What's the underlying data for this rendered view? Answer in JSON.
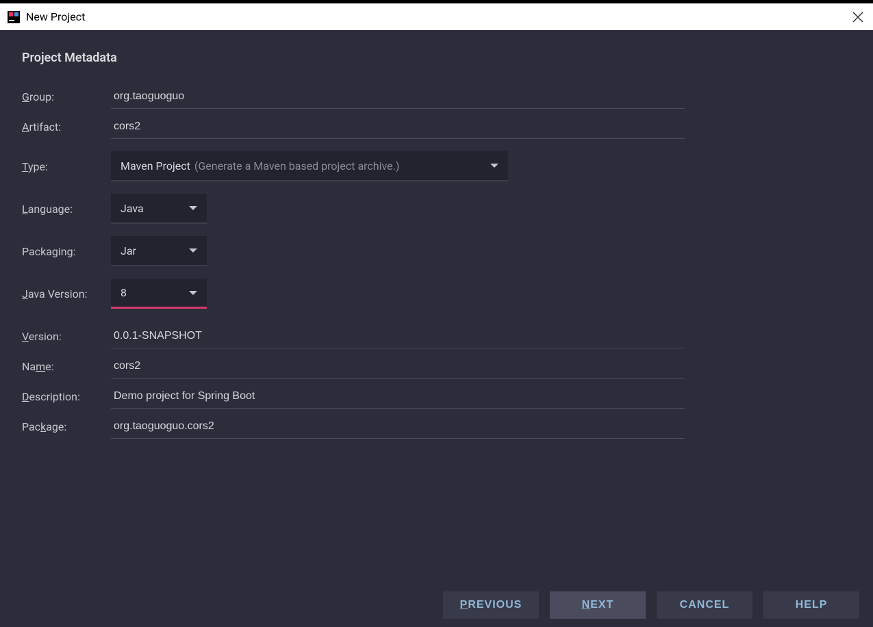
{
  "titlebar": {
    "title": "New Project"
  },
  "section_title": "Project Metadata",
  "labels": {
    "group": "roup:",
    "artifact": "rtifact:",
    "type": "ype:",
    "language": "anguage:",
    "packaging": "Packa",
    "packaging_u": "g",
    "packaging_suf": "ing:",
    "java_version": "ava Version:",
    "version": "ersion:",
    "name": "Na",
    "name_u": "m",
    "name_suf": "e:",
    "description": "escription:",
    "package": "Pac",
    "package_u": "k",
    "package_suf": "age:"
  },
  "values": {
    "group": "org.taoguoguo",
    "artifact": "cors2",
    "type": "Maven Project",
    "type_hint": "(Generate a Maven based project archive.)",
    "language": "Java",
    "packaging": "Jar",
    "java_version": "8",
    "version": "0.0.1-SNAPSHOT",
    "name": "cors2",
    "description": "Demo project for Spring Boot",
    "package": "org.taoguoguo.cors2"
  },
  "footer": {
    "previous": "REVIOUS",
    "next_pre": "",
    "next_u": "N",
    "next_suf": "EXT",
    "cancel": "CANCEL",
    "help": "HELP"
  }
}
